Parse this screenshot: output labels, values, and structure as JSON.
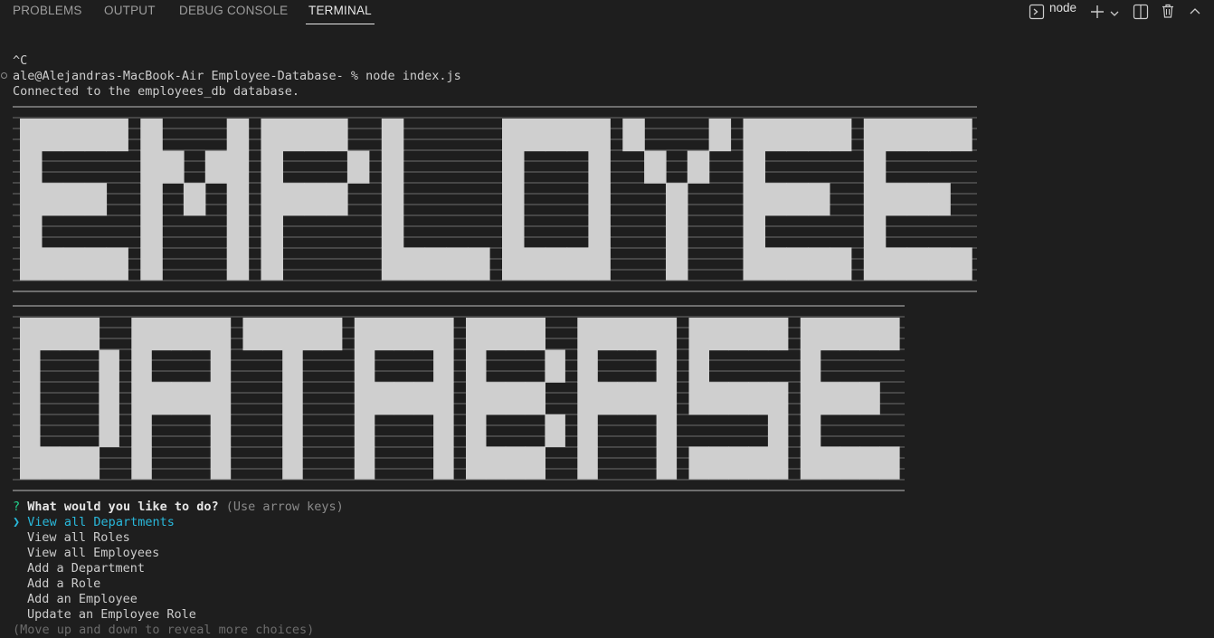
{
  "panel": {
    "tabs": [
      {
        "label": "PROBLEMS"
      },
      {
        "label": "OUTPUT"
      },
      {
        "label": "DEBUG CONSOLE"
      },
      {
        "label": "TERMINAL",
        "active": true
      }
    ],
    "terminal_name": "node",
    "icons": [
      "terminal-icon",
      "plus-icon",
      "chevron-down-icon",
      "split-icon",
      "trash-icon",
      "chevron-up-icon"
    ]
  },
  "terminal": {
    "interrupt": "^C",
    "prompt": "ale@Alejandras-MacBook-Air Employee-Database- % node index.js",
    "connected": "Connected to the employees_db database.",
    "banner_line1": "EMPLOYEE",
    "banner_line2": "DATABASE",
    "question_mark": "?",
    "question": "What would you like to do?",
    "hint": "(Use arrow keys)",
    "pointer": "❯",
    "choices": [
      "View all Departments",
      "View all Roles",
      "View all Employees",
      "Add a Department",
      "Add a Role",
      "Add an Employee",
      "Update an Employee Role"
    ],
    "footer_hint": "(Move up and down to reveal more choices)"
  },
  "colors": {
    "background": "#1e1e1e",
    "text": "#cccccc",
    "selected": "#29b8db",
    "question_mark": "#23d18b",
    "banner_fill": "#cfcfcf"
  }
}
